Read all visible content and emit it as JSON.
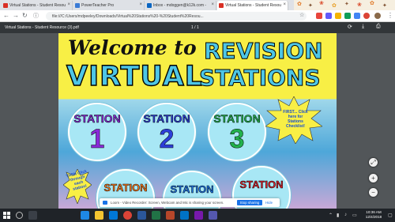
{
  "browser": {
    "tabs": [
      {
        "title": "Virtual Stations - Student Resou",
        "favicon_color": "#d93025",
        "active": false
      },
      {
        "title": "PowerTeacher Pro",
        "favicon_color": "#3a7bd5",
        "active": false
      },
      {
        "title": "Inbox - mdoggen@k12k.com -",
        "favicon_color": "#0a66c2",
        "active": false
      },
      {
        "title": "Virtual Stations - Student Resou",
        "favicon_color": "#d93025",
        "active": true
      }
    ],
    "address": "file:///C:/Users/mdpeeley/Downloads/Virtual%20Stations%20-%20Student%20Resou..."
  },
  "pdf_viewer": {
    "filename": "Virtual Stations - Student Resource (3).pdf",
    "page_indicator": "1 / 1",
    "icons": [
      "rotate-icon",
      "download-icon",
      "print-icon"
    ]
  },
  "page": {
    "welcome": "Welcome to",
    "virtual": "VIRTUAL",
    "revision": "REVISION",
    "stations": "STATIONS",
    "station_word": "STATION",
    "stations_list": [
      {
        "number": "1",
        "color": "#8a2bd9"
      },
      {
        "number": "2",
        "color": "#2d3fd8"
      },
      {
        "number": "3",
        "color": "#22b14c"
      }
    ],
    "stations_row2": [
      {
        "color": "#ff7a1a"
      },
      {
        "color": "#1a73e8"
      },
      {
        "color": "#e0202a"
      }
    ],
    "burst_text": "FIRST... Click here for Stations Checklist!",
    "then_text": "THEN Click through each station!"
  },
  "zoom": {
    "fit": "⤢",
    "plus": "+",
    "minus": "−"
  },
  "share_bar": {
    "message": "Loom - Video Recorder: Screen, Webcam and Mic is sharing your screen.",
    "stop_label": "Stop sharing",
    "hide_label": "Hide"
  },
  "taskbar": {
    "time": "10:36 AM",
    "date": "12/4/2018"
  }
}
